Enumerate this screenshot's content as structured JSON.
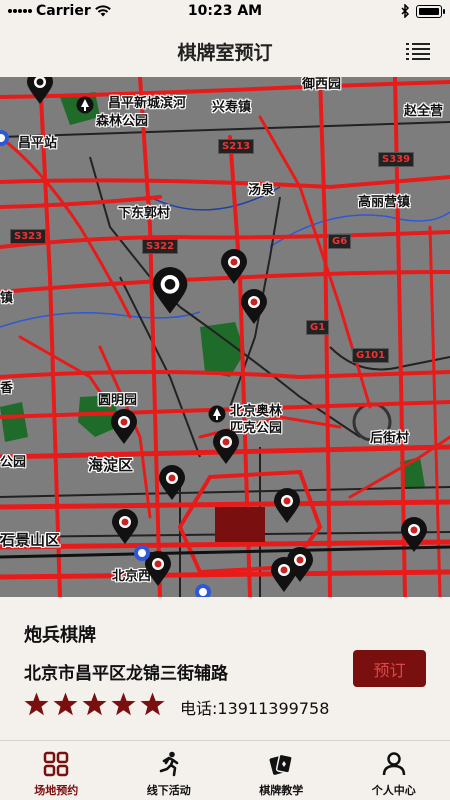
{
  "status_bar": {
    "carrier": "Carrier",
    "time": "10:23 AM"
  },
  "nav": {
    "title": "棋牌室预订",
    "menu_icon": "list-icon"
  },
  "map": {
    "labels": {
      "place_changping_xincheng": "昌平新城滨河",
      "place_senlin_gongyuan": "森林公园",
      "place_xingshou": "兴寿镇",
      "place_zhaoquanying": "赵全营",
      "place_changping_station": "昌平站",
      "place_xiaotang": "汤泉",
      "place_gaoliying": "高丽营镇",
      "place_xiadongguo": "下东郭村",
      "place_zhen": "镇",
      "place_yuanmingyuan": "圆明园",
      "place_beijing_olympic": "北京奥林",
      "place_olympic_park": "匹克公园",
      "place_haidian": "海淀区",
      "place_gongyuan": "公园",
      "place_houjiacun": "后街村",
      "place_shijingshan": "石景山区",
      "place_beijingxi": "北京西",
      "place_yuhecheng": "御西园",
      "place_xiang": "香"
    },
    "road_signs": {
      "s213": "S213",
      "s339": "S339",
      "s323": "S323",
      "s322": "S322",
      "g6": "G6",
      "g1": "G1",
      "g101": "G101"
    }
  },
  "venue": {
    "name": "炮兵棋牌",
    "address": "北京市昌平区龙锦三街辅路",
    "phone": "电话:13911399758",
    "rating": 5,
    "book_label": "预订"
  },
  "tabs": [
    {
      "label": "场地预约",
      "icon": "grid-icon",
      "active": true
    },
    {
      "label": "线下活动",
      "icon": "runner-icon",
      "active": false
    },
    {
      "label": "棋牌教学",
      "icon": "cards-icon",
      "active": false
    },
    {
      "label": "个人中心",
      "icon": "user-icon",
      "active": false
    }
  ],
  "colors": {
    "accent": "#7a0f0f",
    "road": "#e81b1b",
    "background": "#f4f0ec"
  }
}
